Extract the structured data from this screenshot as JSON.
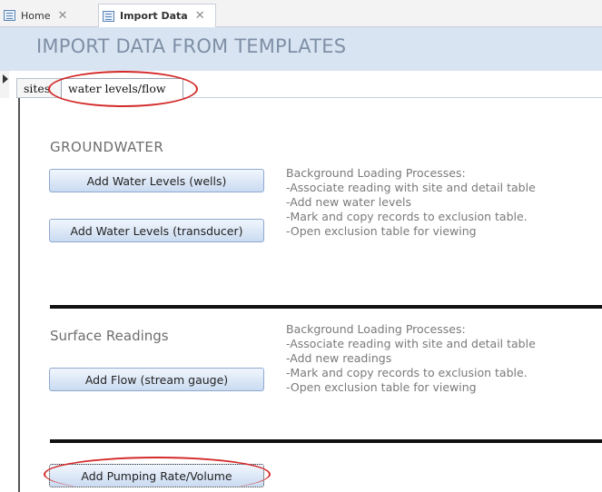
{
  "tabs": {
    "home_label": "Home",
    "import_label": "Import Data"
  },
  "header": {
    "title": "IMPORT DATA FROM TEMPLATES"
  },
  "form_tabs": {
    "sites": "sites",
    "water_levels_flow": "water levels/flow"
  },
  "groundwater": {
    "label": "GROUNDWATER",
    "add_wells": "Add Water Levels (wells)",
    "add_transducer": "Add Water Levels (transducer)",
    "notes": [
      "Background Loading Processes:",
      "-Associate reading with site and detail table",
      "-Add new water levels",
      "-Mark and copy records to exclusion table.",
      "-Open exclusion table for viewing"
    ]
  },
  "surface": {
    "label": "Surface Readings",
    "add_flow": "Add Flow (stream gauge)",
    "notes": [
      "Background Loading Processes:",
      "-Associate reading with site and detail table",
      "-Add new readings",
      "-Mark and copy records to exclusion table.",
      "-Open exclusion table for viewing"
    ]
  },
  "pumping": {
    "add_pumping": "Add Pumping Rate/Volume"
  },
  "colors": {
    "header_bg": "#d8e4f1",
    "title": "#7f8fa6",
    "highlight_ellipse": "#d42a2a",
    "button_top": "#f1f6fd",
    "button_bottom": "#cadbf1"
  }
}
